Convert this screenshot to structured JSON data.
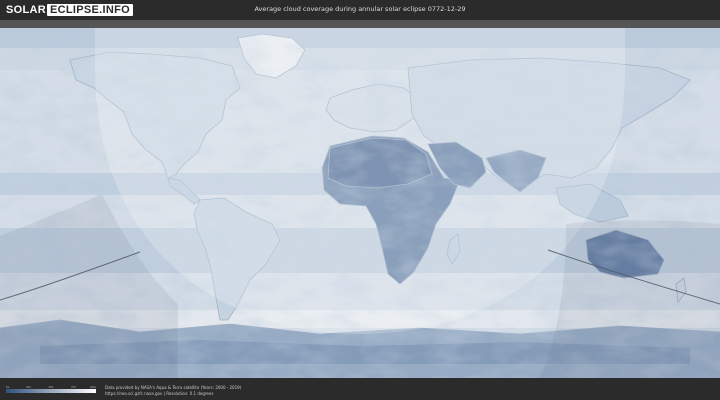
{
  "header": {
    "logo_part1": "SOLAR",
    "logo_part2": "ECLIPSE.INFO",
    "title": "Average cloud coverage during annular solar eclipse 0772-12-29"
  },
  "legend": {
    "ticks": [
      "0%",
      "25%",
      "50%",
      "75%",
      "100%"
    ],
    "color_low": "#33507e",
    "color_high": "#ffffff"
  },
  "footer": {
    "credit_line1": "Data provided by NASA's Aqua & Terra satellite (Years: 2000 - 2019)",
    "credit_line2": "https://neo.sci.gsfc.nasa.gov | Resolution: 0.1 degrees"
  },
  "map": {
    "visibility_color": "#ffffff",
    "path_color": "#505a66"
  }
}
